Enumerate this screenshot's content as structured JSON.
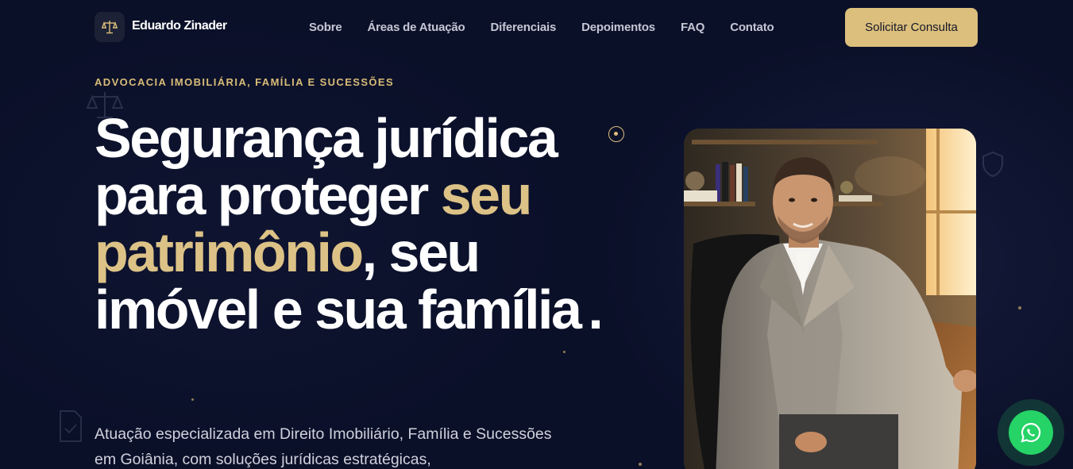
{
  "header": {
    "brand": "Eduardo Zinader",
    "logo_icon": "scales-of-justice-icon",
    "nav": [
      "Sobre",
      "Áreas de Atuação",
      "Diferenciais",
      "Depoimentos",
      "FAQ",
      "Contato"
    ],
    "cta_label": "Solicitar Consulta"
  },
  "hero": {
    "eyebrow": "ADVOCACIA IMOBILIÁRIA, FAMÍLIA E SUCESSÕES",
    "headline": {
      "part1": "Segurança jurídica para proteger ",
      "highlight": "seu patrimônio",
      "part2": ", seu imóvel e sua família",
      "period": "."
    },
    "subtitle": "Atuação especializada em Direito Imobiliário, Família e Sucessões em Goiânia, com soluções jurídicas estratégicas,",
    "photo_icon": "lawyer-portrait-photo"
  },
  "floating": {
    "whatsapp_icon": "whatsapp-icon"
  },
  "colors": {
    "background": "#0b1029",
    "accent_gold": "#dcbf7c",
    "whatsapp_green": "#25d366"
  }
}
